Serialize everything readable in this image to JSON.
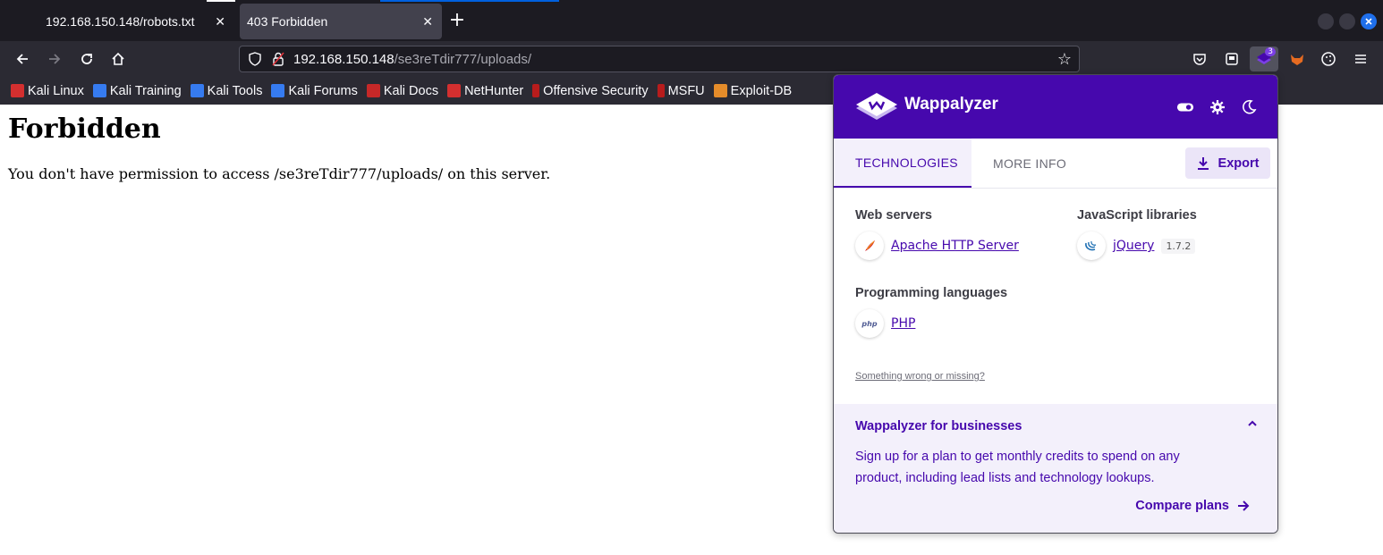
{
  "browser": {
    "tabs": [
      {
        "title": "192.168.150.148/robots.txt",
        "active": false
      },
      {
        "title": "403 Forbidden",
        "active": true
      }
    ],
    "url": {
      "host": "192.168.150.148",
      "path": "/se3reTdir777/uploads/"
    },
    "extension_badge": "3",
    "bookmarks": [
      "Kali Linux",
      "Kali Training",
      "Kali Tools",
      "Kali Forums",
      "Kali Docs",
      "NetHunter",
      "Offensive Security",
      "MSFU",
      "Exploit-DB"
    ],
    "colors": {
      "tabstrip": "#1c1b22",
      "toolbar": "#2b2a33",
      "accent": "#4608ad",
      "close_red": "#e0343c"
    }
  },
  "page": {
    "heading": "Forbidden",
    "message": "You don't have permission to access /se3reTdir777/uploads/ on this server."
  },
  "wappalyzer": {
    "title": "Wappalyzer",
    "tabs": {
      "technologies": "TECHNOLOGIES",
      "more_info": "MORE INFO"
    },
    "export_label": "Export",
    "categories": {
      "web_servers": {
        "title": "Web servers",
        "items": [
          {
            "name": "Apache HTTP Server"
          }
        ]
      },
      "javascript_libraries": {
        "title": "JavaScript libraries",
        "items": [
          {
            "name": "jQuery",
            "version": "1.7.2"
          }
        ]
      },
      "programming_languages": {
        "title": "Programming languages",
        "items": [
          {
            "name": "PHP"
          }
        ]
      }
    },
    "something_wrong": "Something wrong or missing?",
    "business": {
      "title": "Wappalyzer for businesses",
      "text": "Sign up for a plan to get monthly credits to spend on any product, including lead lists and technology lookups.",
      "compare_label": "Compare plans"
    }
  }
}
